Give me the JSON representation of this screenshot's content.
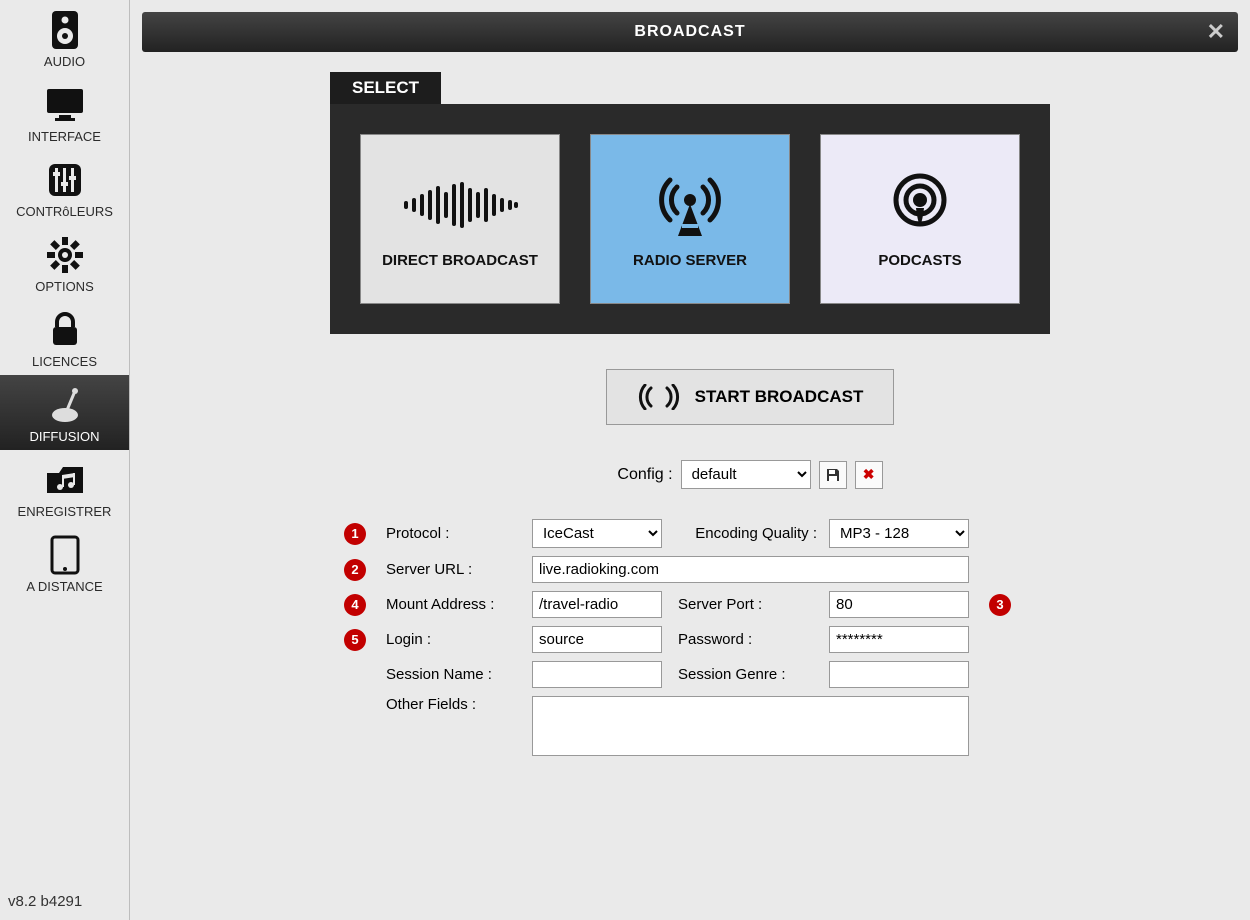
{
  "sidebar": {
    "items": [
      {
        "label": "AUDIO"
      },
      {
        "label": "INTERFACE"
      },
      {
        "label": "CONTRôLEURS"
      },
      {
        "label": "OPTIONS"
      },
      {
        "label": "LICENCES"
      },
      {
        "label": "DIFFUSION"
      },
      {
        "label": "ENREGISTRER"
      },
      {
        "label": "A DISTANCE"
      }
    ],
    "version": "v8.2 b4291"
  },
  "titlebar": {
    "title": "BROADCAST"
  },
  "select": {
    "tab": "SELECT",
    "cards": [
      {
        "label": "DIRECT BROADCAST"
      },
      {
        "label": "RADIO SERVER"
      },
      {
        "label": "PODCASTS"
      }
    ]
  },
  "start_button": "START BROADCAST",
  "config": {
    "label": "Config :",
    "value": "default"
  },
  "form": {
    "protocol_label": "Protocol :",
    "protocol_value": "IceCast",
    "encoding_label": "Encoding Quality :",
    "encoding_value": "MP3 - 128",
    "server_url_label": "Server URL :",
    "server_url_value": "live.radioking.com",
    "mount_label": "Mount Address :",
    "mount_value": "/travel-radio",
    "port_label": "Server Port :",
    "port_value": "80",
    "login_label": "Login :",
    "login_value": "source",
    "password_label": "Password :",
    "password_value": "********",
    "session_name_label": "Session Name :",
    "session_name_value": "",
    "session_genre_label": "Session Genre :",
    "session_genre_value": "",
    "other_label": "Other Fields :",
    "other_value": "",
    "badges": {
      "b1": "1",
      "b2": "2",
      "b3": "3",
      "b4": "4",
      "b5": "5"
    }
  }
}
